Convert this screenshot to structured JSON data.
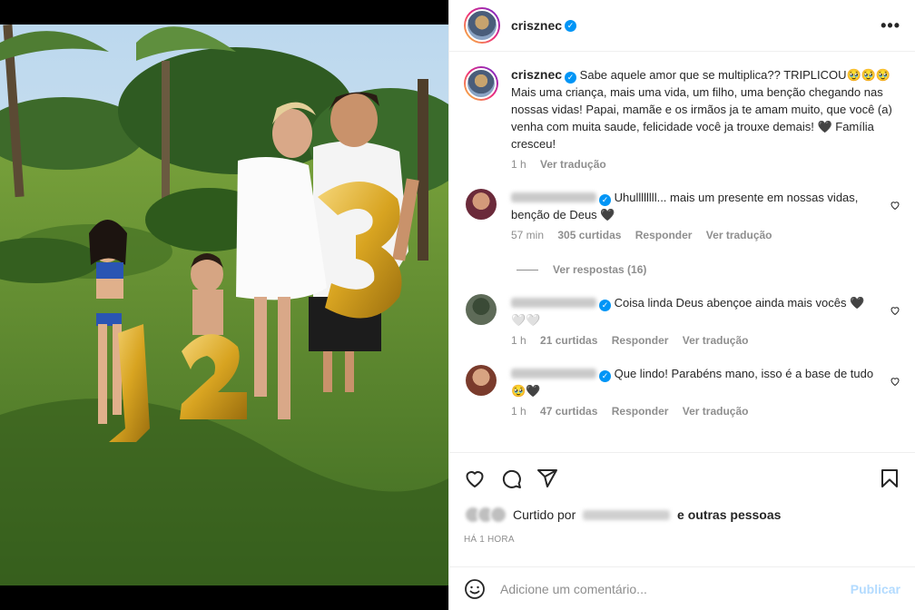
{
  "post": {
    "username": "crisznec",
    "verified_mark": "✓",
    "more_icon": "more-options-icon"
  },
  "caption": {
    "username": "crisznec",
    "text": "Sabe aquele amor que se multiplica?? TRIPLICOU🥹🥹🥹 Mais uma criança, mais uma vida, um filho, uma benção chegando nas nossas vidas! Papai, mamãe e os irmãos ja te amam muito, que você (a) venha com muita saude, felicidade você ja trouxe demais! 🖤 Família cresceu!",
    "time": "1 h",
    "translate": "Ver tradução"
  },
  "comments": [
    {
      "text": "Uhullllllll... mais um presente em nossas vidas, benção de Deus 🖤",
      "time": "57 min",
      "likes": "305 curtidas",
      "reply": "Responder",
      "translate": "Ver tradução",
      "avatar_color": "#6b2a3a"
    },
    {
      "text": "Coisa linda Deus abençoe ainda mais vocês 🖤🤍🤍",
      "time": "1 h",
      "likes": "21 curtidas",
      "reply": "Responder",
      "translate": "Ver tradução",
      "avatar_color": "#5e6b58"
    },
    {
      "text": "Que lindo! Parabéns mano, isso é a base de tudo 🥹🖤",
      "time": "1 h",
      "likes": "47 curtidas",
      "reply": "Responder",
      "translate": "Ver tradução",
      "avatar_color": "#7a3b2c"
    }
  ],
  "replies_label": "Ver respostas (16)",
  "likes_line": {
    "prefix": "Curtido por",
    "suffix": "e outras pessoas"
  },
  "timestamp": "HÁ 1 HORA",
  "add_comment": {
    "placeholder": "Adicione um comentário...",
    "post_label": "Publicar"
  },
  "photo": {
    "balloon_numbers": [
      "1",
      "2",
      "3"
    ],
    "balloon_color": "#e2b632"
  }
}
